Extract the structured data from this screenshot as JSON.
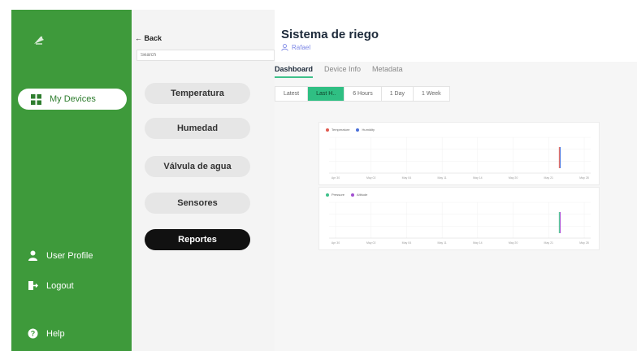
{
  "sidebar": {
    "logo_icon": "dish-icon",
    "active_item": {
      "label": "My Devices",
      "icon": "grid-icon"
    },
    "items": [
      {
        "label": "User Profile",
        "icon": "user-icon"
      },
      {
        "label": "Logout",
        "icon": "logout-icon"
      },
      {
        "label": "Help",
        "icon": "help-circle-icon"
      }
    ]
  },
  "middle": {
    "back_label": "← Back",
    "search_placeholder": "Search",
    "categories": [
      "Temperatura",
      "Humedad",
      "Válvula de agua",
      "Sensores",
      "Reportes"
    ],
    "active_category": "Reportes"
  },
  "header": {
    "title": "Sistema de riego",
    "user": "Rafael"
  },
  "tabs": [
    {
      "label": "Dashboard",
      "active": true
    },
    {
      "label": "Device Info",
      "active": false
    },
    {
      "label": "Metadata",
      "active": false
    }
  ],
  "ranges": [
    {
      "label": "Latest",
      "active": false
    },
    {
      "label": "Last H..",
      "active": true
    },
    {
      "label": "6 Hours",
      "active": false
    },
    {
      "label": "1 Day",
      "active": false
    },
    {
      "label": "1 Week",
      "active": false
    }
  ],
  "colors": {
    "sidebar_green": "#3e9a3b",
    "accent_teal": "#2fbf83",
    "series_red": "#e05a4f",
    "series_blue": "#4a6fd8",
    "series_green": "#3ec18a",
    "series_purple": "#a24fd0"
  },
  "chart_data": [
    {
      "type": "line",
      "series": [
        {
          "name": "Temperature",
          "color": "#e05a4f"
        },
        {
          "name": "Humidity",
          "color": "#4a6fd8"
        }
      ],
      "x_ticks": [
        "Apr 30",
        "May 02",
        "May 04",
        "May 11",
        "May 14",
        "May 20",
        "May 21",
        "May 28"
      ],
      "spike_at": 0.88
    },
    {
      "type": "line",
      "series": [
        {
          "name": "Pressure",
          "color": "#3ec18a"
        },
        {
          "name": "Altitude",
          "color": "#a24fd0"
        }
      ],
      "x_ticks": [
        "Apr 30",
        "May 02",
        "May 04",
        "May 11",
        "May 14",
        "May 20",
        "May 21",
        "May 28"
      ],
      "spike_at": 0.88
    }
  ]
}
